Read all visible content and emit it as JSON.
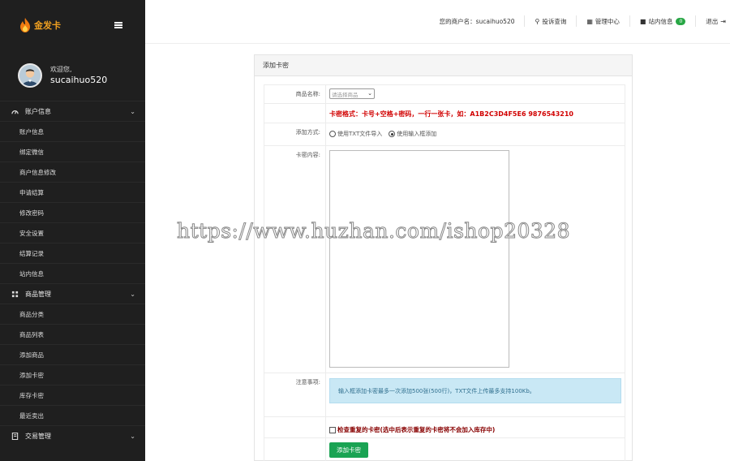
{
  "brand": {
    "name": "金发卡",
    "icon": "flame-icon",
    "color": "#f0a020"
  },
  "sidebar": {
    "welcome": "欢迎您,",
    "username": "sucaihuo520",
    "groups": [
      {
        "label": "账户信息",
        "icon": "speedometer-icon",
        "items": [
          "账户信息",
          "绑定微信",
          "商户信息修改",
          "申请结算",
          "修改密码",
          "安全设置",
          "结算记录",
          "站内信息"
        ]
      },
      {
        "label": "商品管理",
        "icon": "grid-icon",
        "items": [
          "商品分类",
          "商品列表",
          "添加商品",
          "添加卡密",
          "库存卡密",
          "最近卖出"
        ]
      },
      {
        "label": "交易管理",
        "icon": "book-icon",
        "items": []
      }
    ]
  },
  "topbar": {
    "merchant": "您的商户名：sucaihuo520",
    "complaint": "投诉查询",
    "admin": "管理中心",
    "messages": "站内信息",
    "message_count": "0",
    "logout": "退出"
  },
  "panel": {
    "title": "添加卡密",
    "product_label": "商品名称:",
    "product_select": "请选择商品",
    "format_hint": "卡密格式：卡号+空格+密码，一行一张卡，如：A1B2C3D4F5E6 9876543210",
    "method_label": "添加方式:",
    "method_options": [
      "使用TXT文件导入",
      "使用输入框添加"
    ],
    "method_selected": 1,
    "content_label": "卡密内容:",
    "notice_label": "注意事项:",
    "notice_text": "输入框添加卡密最多一次添加500张(500行)，TXT文件上传最多支持100Kb。",
    "check_dup": "检查重复的卡密(选中后表示重复的卡密将不会加入库存中)",
    "submit": "添加卡密"
  },
  "watermark": "https://www.huzhan.com/ishop20328",
  "colors": {
    "sidebar_bg": "#1f1f1f",
    "accent_green": "#1aa353",
    "format_red": "#d10000",
    "notice_bg": "#c9e8f5"
  }
}
